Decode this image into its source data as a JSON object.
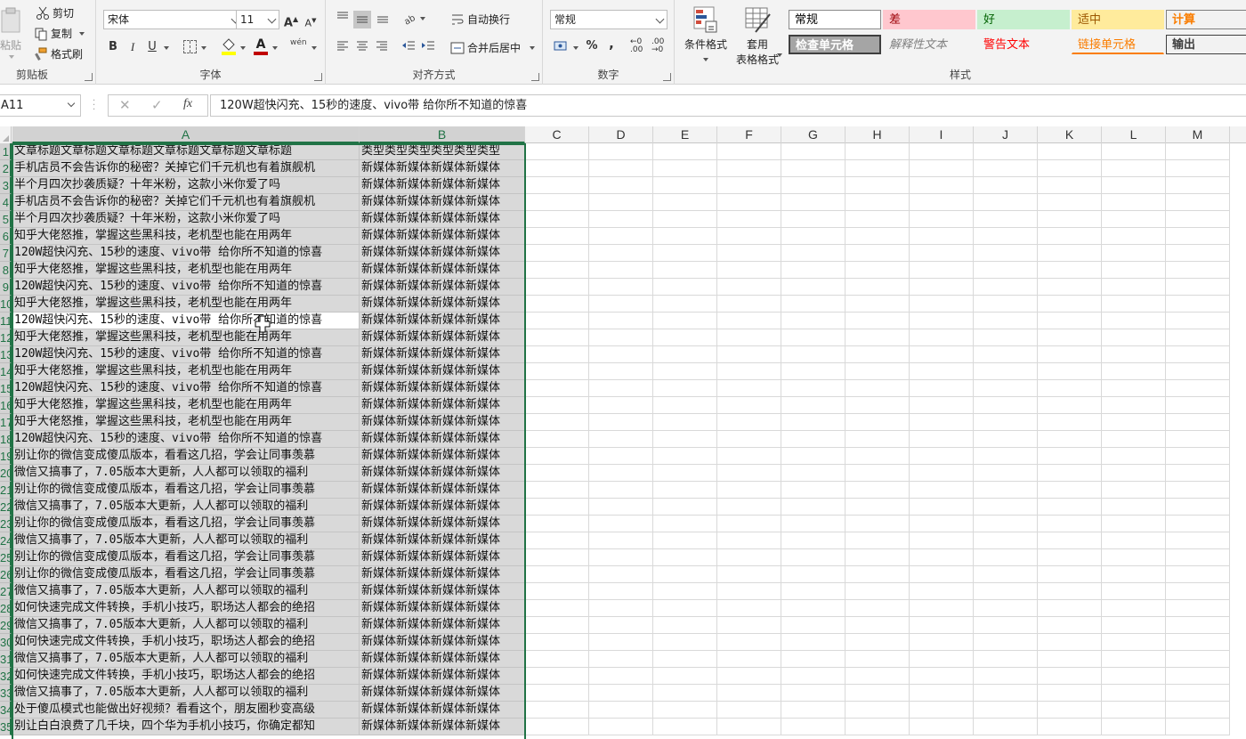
{
  "ribbon": {
    "clipboard": {
      "label": "剪贴板",
      "paste": "粘贴",
      "cut": "剪切",
      "copy": "复制",
      "format_painter": "格式刷"
    },
    "font": {
      "label": "字体",
      "font_name": "宋体",
      "font_size": "11",
      "bold": "B",
      "italic": "I",
      "underline": "U",
      "phonetic": "wén"
    },
    "alignment": {
      "label": "对齐方式",
      "wrap_text": "自动换行",
      "merge_center": "合并后居中"
    },
    "number": {
      "label": "数字",
      "format": "常规",
      "percent": "%",
      "comma": ","
    },
    "styles": {
      "label": "样式",
      "conditional_format": "条件格式",
      "format_as_table_1": "套用",
      "format_as_table_2": "表格格式",
      "cells": [
        {
          "text": "常规",
          "bg": "#ffffff",
          "color": "#000000",
          "border": "#8a8a8a"
        },
        {
          "text": "差",
          "bg": "#ffc7ce",
          "color": "#9c0006",
          "border": "#ffc7ce"
        },
        {
          "text": "好",
          "bg": "#c6efce",
          "color": "#006100",
          "border": "#c6efce"
        },
        {
          "text": "适中",
          "bg": "#ffeb9c",
          "color": "#9c5700",
          "border": "#ffeb9c"
        },
        {
          "text": "计算",
          "bg": "#f2f2f2",
          "color": "#fa7d00",
          "border": "#7f7f7f"
        },
        {
          "text": "检查单元格",
          "bg": "#a5a5a5",
          "color": "#ffffff",
          "border": "#3f3f3f"
        },
        {
          "text": "解释性文本",
          "bg": "transparent",
          "color": "#7f7f7f",
          "border": "transparent"
        },
        {
          "text": "警告文本",
          "bg": "transparent",
          "color": "#ff0000",
          "border": "transparent"
        },
        {
          "text": "链接单元格",
          "bg": "transparent",
          "color": "#fa7d00",
          "border": "transparent"
        },
        {
          "text": "输出",
          "bg": "#f2f2f2",
          "color": "#3f3f3f",
          "border": "#3f3f3f"
        }
      ]
    }
  },
  "formula_bar": {
    "name_box": "A11",
    "cancel": "✕",
    "enter": "✓",
    "fx": "fx",
    "content": "120W超快闪充、15秒的速度、vivo带 给你所不知道的惊喜"
  },
  "sheet": {
    "columns": [
      "A",
      "B",
      "C",
      "D",
      "E",
      "F",
      "G",
      "H",
      "I",
      "J",
      "K",
      "L",
      "M"
    ],
    "selected_columns": [
      "A",
      "B"
    ],
    "active_row": 11,
    "rows": [
      {
        "n": "1",
        "a": "文章标题文章标题文章标题文章标题文章标题文章标题",
        "b": "类型类型类型类型类型类型"
      },
      {
        "n": "2",
        "a": "手机店员不会告诉你的秘密？关掉它们千元机也有着旗舰机",
        "b": "新媒体新媒体新媒体新媒体"
      },
      {
        "n": "3",
        "a": "半个月四次抄袭质疑？十年米粉，这款小米你爱了吗",
        "b": "新媒体新媒体新媒体新媒体"
      },
      {
        "n": "4",
        "a": "手机店员不会告诉你的秘密？关掉它们千元机也有着旗舰机",
        "b": "新媒体新媒体新媒体新媒体"
      },
      {
        "n": "5",
        "a": "半个月四次抄袭质疑？十年米粉，这款小米你爱了吗",
        "b": "新媒体新媒体新媒体新媒体"
      },
      {
        "n": "6",
        "a": "知乎大佬怒推，掌握这些黑科技，老机型也能在用两年",
        "b": "新媒体新媒体新媒体新媒体"
      },
      {
        "n": "7",
        "a": "120W超快闪充、15秒的速度、vivo带 给你所不知道的惊喜",
        "b": "新媒体新媒体新媒体新媒体"
      },
      {
        "n": "8",
        "a": "知乎大佬怒推，掌握这些黑科技，老机型也能在用两年",
        "b": "新媒体新媒体新媒体新媒体"
      },
      {
        "n": "9",
        "a": "120W超快闪充、15秒的速度、vivo带 给你所不知道的惊喜",
        "b": "新媒体新媒体新媒体新媒体"
      },
      {
        "n": "10",
        "a": "知乎大佬怒推，掌握这些黑科技，老机型也能在用两年",
        "b": "新媒体新媒体新媒体新媒体"
      },
      {
        "n": "11",
        "a": "120W超快闪充、15秒的速度、vivo带 给你所不知道的惊喜",
        "b": "新媒体新媒体新媒体新媒体"
      },
      {
        "n": "12",
        "a": "知乎大佬怒推，掌握这些黑科技，老机型也能在用两年",
        "b": "新媒体新媒体新媒体新媒体"
      },
      {
        "n": "13",
        "a": "120W超快闪充、15秒的速度、vivo带 给你所不知道的惊喜",
        "b": "新媒体新媒体新媒体新媒体"
      },
      {
        "n": "14",
        "a": "知乎大佬怒推，掌握这些黑科技，老机型也能在用两年",
        "b": "新媒体新媒体新媒体新媒体"
      },
      {
        "n": "15",
        "a": "120W超快闪充、15秒的速度、vivo带 给你所不知道的惊喜",
        "b": "新媒体新媒体新媒体新媒体"
      },
      {
        "n": "16",
        "a": "知乎大佬怒推，掌握这些黑科技，老机型也能在用两年",
        "b": "新媒体新媒体新媒体新媒体"
      },
      {
        "n": "17",
        "a": "知乎大佬怒推，掌握这些黑科技，老机型也能在用两年",
        "b": "新媒体新媒体新媒体新媒体"
      },
      {
        "n": "18",
        "a": "120W超快闪充、15秒的速度、vivo带 给你所不知道的惊喜",
        "b": "新媒体新媒体新媒体新媒体"
      },
      {
        "n": "19",
        "a": "别让你的微信变成傻瓜版本，看看这几招，学会让同事羡慕",
        "b": "新媒体新媒体新媒体新媒体"
      },
      {
        "n": "20",
        "a": "微信又搞事了，7.05版本大更新，人人都可以领取的福利",
        "b": "新媒体新媒体新媒体新媒体"
      },
      {
        "n": "21",
        "a": "别让你的微信变成傻瓜版本，看看这几招，学会让同事羡慕",
        "b": "新媒体新媒体新媒体新媒体"
      },
      {
        "n": "22",
        "a": "微信又搞事了，7.05版本大更新，人人都可以领取的福利",
        "b": "新媒体新媒体新媒体新媒体"
      },
      {
        "n": "23",
        "a": "别让你的微信变成傻瓜版本，看看这几招，学会让同事羡慕",
        "b": "新媒体新媒体新媒体新媒体"
      },
      {
        "n": "24",
        "a": "微信又搞事了，7.05版本大更新，人人都可以领取的福利",
        "b": "新媒体新媒体新媒体新媒体"
      },
      {
        "n": "25",
        "a": "别让你的微信变成傻瓜版本，看看这几招，学会让同事羡慕",
        "b": "新媒体新媒体新媒体新媒体"
      },
      {
        "n": "26",
        "a": "别让你的微信变成傻瓜版本，看看这几招，学会让同事羡慕",
        "b": "新媒体新媒体新媒体新媒体"
      },
      {
        "n": "27",
        "a": "微信又搞事了，7.05版本大更新，人人都可以领取的福利",
        "b": "新媒体新媒体新媒体新媒体"
      },
      {
        "n": "28",
        "a": "如何快速完成文件转换，手机小技巧，职场达人都会的绝招",
        "b": "新媒体新媒体新媒体新媒体"
      },
      {
        "n": "29",
        "a": "微信又搞事了，7.05版本大更新，人人都可以领取的福利",
        "b": "新媒体新媒体新媒体新媒体"
      },
      {
        "n": "30",
        "a": "如何快速完成文件转换，手机小技巧，职场达人都会的绝招",
        "b": "新媒体新媒体新媒体新媒体"
      },
      {
        "n": "31",
        "a": "微信又搞事了，7.05版本大更新，人人都可以领取的福利",
        "b": "新媒体新媒体新媒体新媒体"
      },
      {
        "n": "32",
        "a": "如何快速完成文件转换，手机小技巧，职场达人都会的绝招",
        "b": "新媒体新媒体新媒体新媒体"
      },
      {
        "n": "33",
        "a": "微信又搞事了，7.05版本大更新，人人都可以领取的福利",
        "b": "新媒体新媒体新媒体新媒体"
      },
      {
        "n": "34",
        "a": "处于傻瓜模式也能做出好视频？看看这个，朋友圈秒变高级",
        "b": "新媒体新媒体新媒体新媒体"
      },
      {
        "n": "35",
        "a": "别让白白浪费了几千块，四个华为手机小技巧，你确定都知",
        "b": "新媒体新媒体新媒体新媒体"
      }
    ]
  },
  "colors": {
    "accent": "#217346",
    "selection_fill": "#d9d9d9",
    "header_bg": "#f3f3f3"
  }
}
